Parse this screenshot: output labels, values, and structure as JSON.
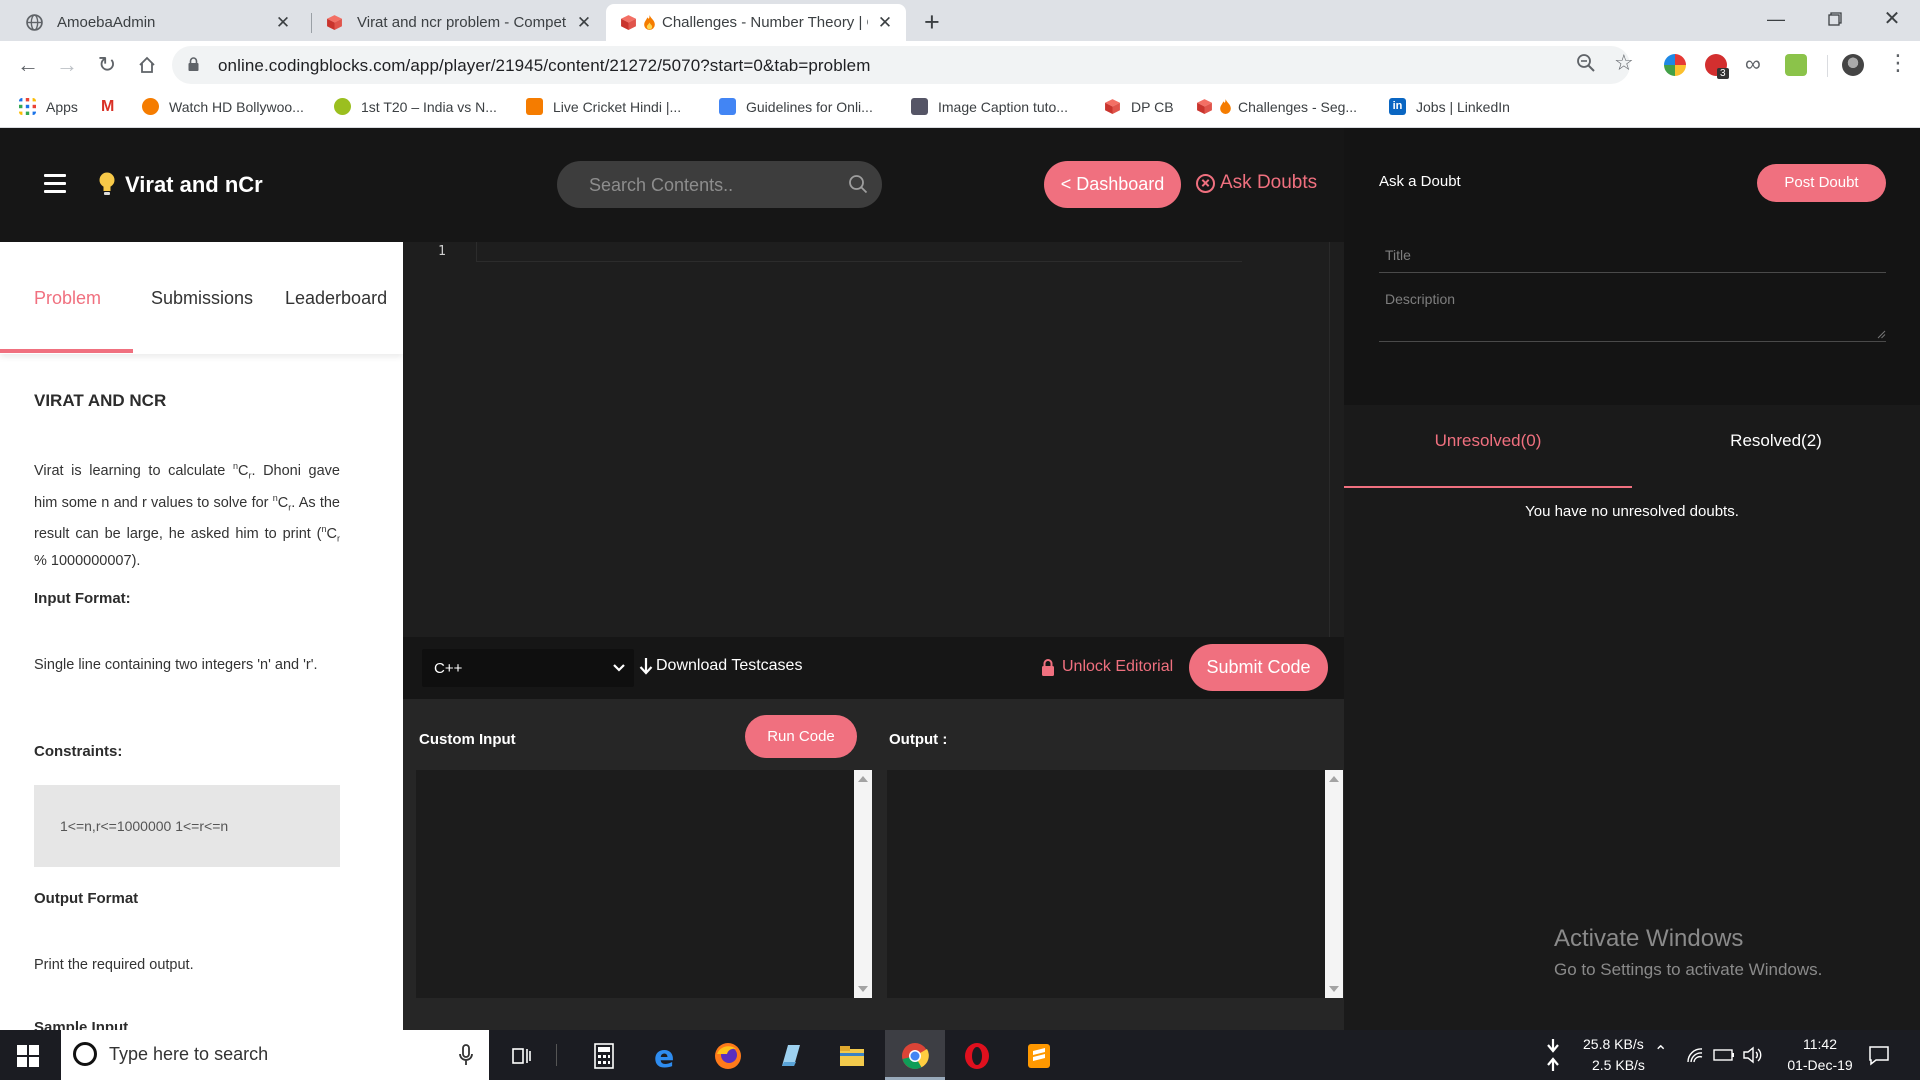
{
  "browser": {
    "tabs": [
      {
        "title": "AmoebaAdmin"
      },
      {
        "title": "Virat and ncr problem - Competitive"
      },
      {
        "title": "Challenges - Number Theory | CB"
      }
    ],
    "url": "online.codingblocks.com/app/player/21945/content/21272/5070?start=0&tab=problem",
    "bookmarks": [
      "Apps",
      "Watch HD Bollywoo...",
      "1st T20 – India vs N...",
      "Live Cricket Hindi |...",
      "Guidelines for Onli...",
      "Image Caption tuto...",
      "DP CB",
      "Challenges - Seg...",
      "Jobs | LinkedIn"
    ],
    "ext_badge": "3"
  },
  "header": {
    "app_title": "Virat and nCr",
    "search_placeholder": "Search Contents..",
    "dashboard_label": "< Dashboard",
    "ask_doubts_label": "Ask Doubts"
  },
  "problem": {
    "tabs": [
      "Problem",
      "Submissions",
      "Leaderboard"
    ],
    "active_tab": "Problem",
    "title": "VIRAT AND NCR",
    "statement": {
      "p1": "Virat is learning to calculate ",
      "p2": "C",
      "p3": ". Dhoni gave him some n and r values to solve for ",
      "p4": "C",
      "p5": ". As the result can be large, he asked him to print (",
      "p6": "C",
      "p7": " % 1000000007).",
      "sup": "n",
      "sub": "r"
    },
    "input_format_heading": "Input Format:",
    "input_format_text": "Single line containing two integers 'n' and 'r'.",
    "constraints_heading": "Constraints:",
    "constraints_text": "1<=n,r<=1000000 1<=r<=n",
    "output_format_heading": "Output Format",
    "output_format_text": "Print the required output.",
    "sample_input_heading": "Sample Input"
  },
  "editor": {
    "line_number": "1",
    "language": "C++",
    "download_label": "Download Testcases",
    "unlock_label": "Unlock Editorial",
    "submit_label": "Submit Code",
    "custom_input_label": "Custom Input",
    "run_label": "Run Code",
    "output_label": "Output :"
  },
  "doubts": {
    "ask_title": "Ask a Doubt",
    "post_label": "Post Doubt",
    "title_placeholder": "Title",
    "description_placeholder": "Description",
    "tabs": [
      "Unresolved(0)",
      "Resolved(2)"
    ],
    "active_tab": "Unresolved(0)",
    "empty_message": "You have no unresolved doubts."
  },
  "watermark": {
    "line1": "Activate Windows",
    "line2": "Go to Settings to activate Windows."
  },
  "taskbar": {
    "search_placeholder": "Type here to search",
    "net_down": "25.8 KB/s",
    "net_up": "2.5 KB/s",
    "time": "11:42",
    "date": "01-Dec-19"
  },
  "colors": {
    "accent": "#f0707f",
    "dark_bg": "#161616",
    "editor_bg": "#1e1e1e"
  }
}
